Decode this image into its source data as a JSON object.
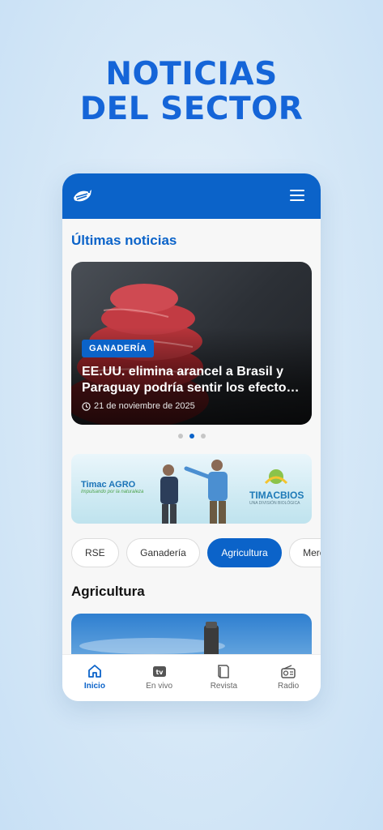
{
  "promo": {
    "line1": "NOTICIAS",
    "line2": "DEL SECTOR"
  },
  "app": {
    "latest_title": "Últimas noticias",
    "featured": {
      "tag": "GANADERÍA",
      "title_line1": "EE.UU. elimina arancel a Brasil y",
      "title_line2": "Paraguay podría sentir los efectos e...",
      "date": "21 de noviembre de 2025"
    },
    "carousel": {
      "count": 3,
      "active": 2
    },
    "banner": {
      "brand_left": "Timac AGRO",
      "brand_left_tagline": "Impulsando por la naturaleza",
      "brand_right": "TIMACBIOS",
      "brand_right_tagline": "UNA DIVISIÓN BIOLÓGICA"
    },
    "chips": [
      "RSE",
      "Ganadería",
      "Agricultura",
      "Mercad"
    ],
    "active_chip": "Agricultura",
    "category_title": "Agricultura",
    "nav": [
      {
        "label": "Inicio",
        "icon": "home-icon",
        "active": true
      },
      {
        "label": "En vivo",
        "icon": "tv-icon",
        "active": false
      },
      {
        "label": "Revista",
        "icon": "book-icon",
        "active": false
      },
      {
        "label": "Radio",
        "icon": "radio-icon",
        "active": false
      }
    ],
    "colors": {
      "primary": "#0b63c9",
      "headline": "#1565d8"
    }
  }
}
